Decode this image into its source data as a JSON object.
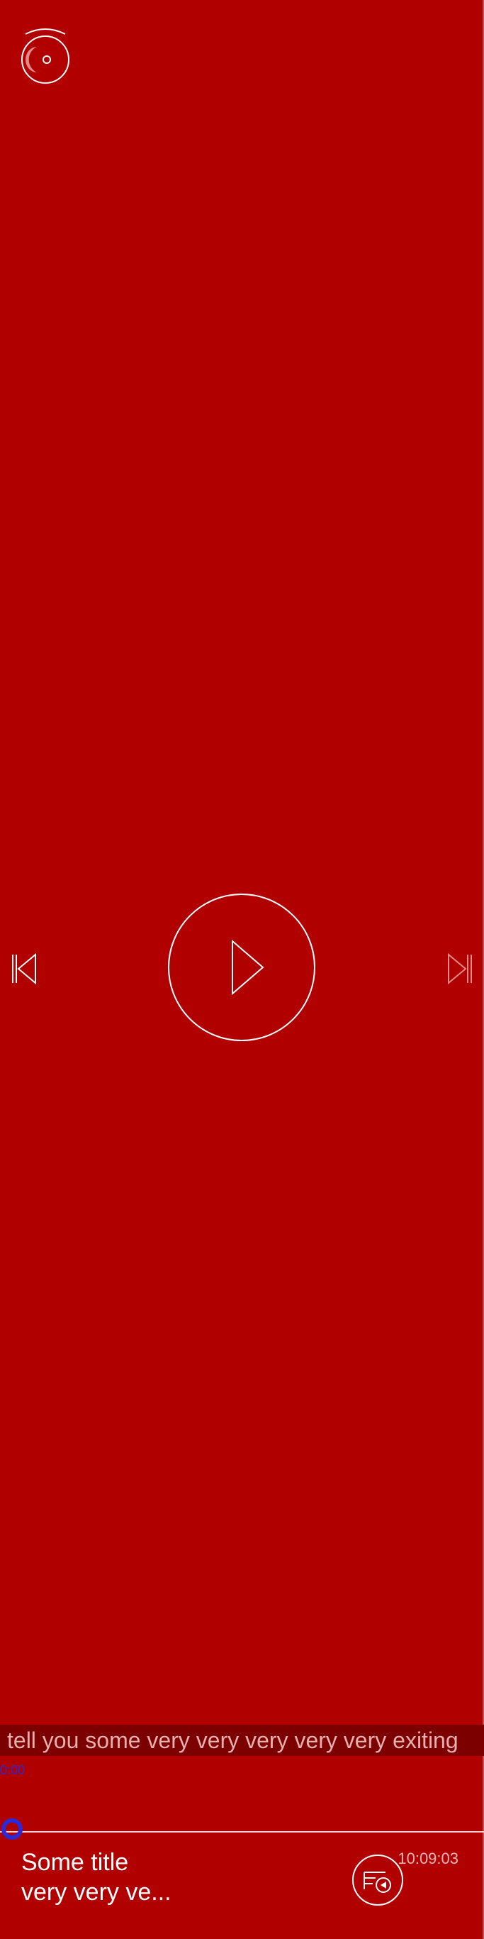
{
  "player": {
    "caption": "tell you some very very very very very exiting",
    "elapsed": "0:00",
    "duration": "10:09:03",
    "progress": 0,
    "title": "Some title",
    "subtitle": "very very ve..."
  },
  "icons": {
    "top": "disc-icon",
    "previous": "skip-previous-icon",
    "play": "play-icon",
    "next": "skip-next-icon",
    "playlist": "playlist-play-icon"
  },
  "colors": {
    "background": "#b00000",
    "caption_strip": "#7d0000",
    "accent_knob": "#2a2ad6",
    "foreground": "#ffffff"
  }
}
